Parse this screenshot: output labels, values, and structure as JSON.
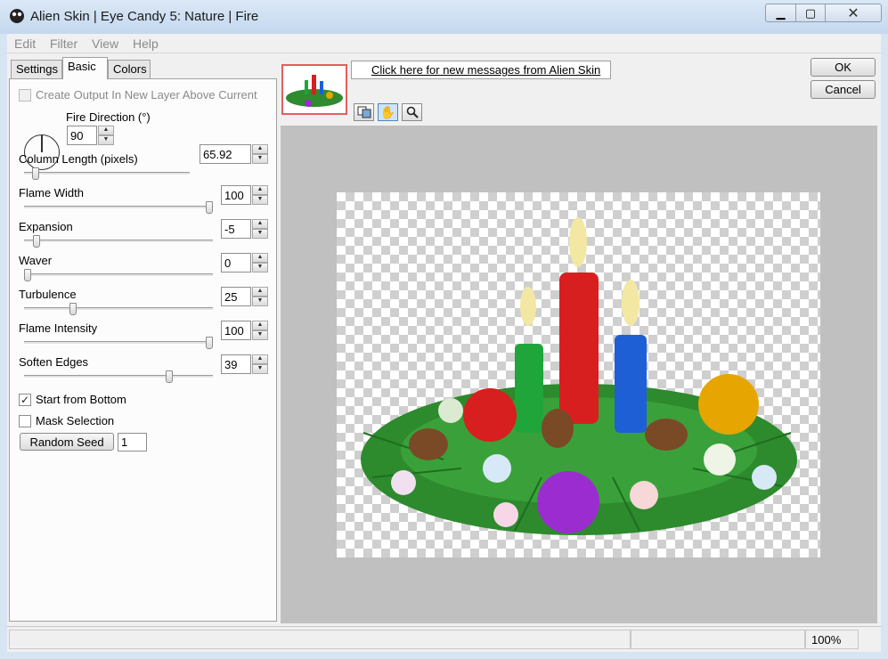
{
  "window": {
    "title": "Alien Skin | Eye Candy 5: Nature | Fire",
    "controls": {
      "minimize": "▁",
      "maximize": "▢",
      "close": "✕"
    }
  },
  "menu": [
    "Edit",
    "Filter",
    "View",
    "Help"
  ],
  "tabs": [
    {
      "label": "Settings",
      "active": false
    },
    {
      "label": "Basic",
      "active": true
    },
    {
      "label": "Colors",
      "active": false
    }
  ],
  "basic": {
    "create_output_label": "Create Output In New Layer Above Current",
    "fire_direction": {
      "label": "Fire Direction (°)",
      "value": "90"
    },
    "sliders": [
      {
        "label": "Column Length (pixels)",
        "value": "65.92",
        "level": 0.05
      },
      {
        "label": "Flame Width",
        "value": "100",
        "level": 1.0
      },
      {
        "label": "Expansion",
        "value": "-5",
        "level": 0.05
      },
      {
        "label": "Waver",
        "value": "0",
        "level": 0.0
      },
      {
        "label": "Turbulence",
        "value": "25",
        "level": 0.25
      },
      {
        "label": "Flame Intensity",
        "value": "100",
        "level": 1.0
      },
      {
        "label": "Soften Edges",
        "value": "39",
        "level": 0.78
      }
    ],
    "start_from_bottom": {
      "label": "Start from Bottom",
      "checked": true
    },
    "mask_selection": {
      "label": "Mask Selection",
      "checked": false
    },
    "random_seed": {
      "button": "Random Seed",
      "value": "1"
    }
  },
  "messages_link": "Click here for new messages from Alien Skin",
  "buttons": {
    "ok": "OK",
    "cancel": "Cancel"
  },
  "tools": [
    "preview-toggle-icon",
    "hand-icon",
    "zoom-icon"
  ],
  "status": {
    "zoom": "100%"
  },
  "colors": {
    "candle_red": "#d81f1f",
    "candle_green": "#1fa53a",
    "candle_blue": "#1e5fd6",
    "ornament_purple": "#9b2ccf",
    "ornament_gold": "#e6a500"
  }
}
